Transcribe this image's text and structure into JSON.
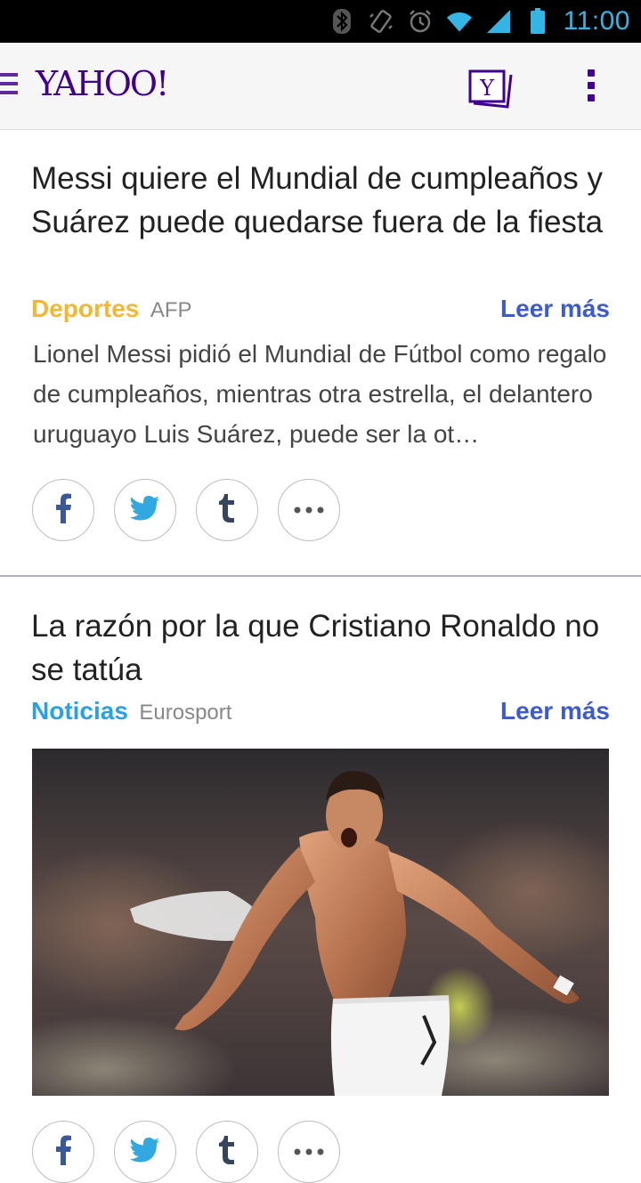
{
  "status_bar": {
    "time": "11:00",
    "icons": [
      "bluetooth-icon",
      "vibrate-icon",
      "alarm-icon",
      "wifi-icon",
      "signal-icon",
      "battery-icon"
    ]
  },
  "app_bar": {
    "logo": "YAHOO!",
    "icons": [
      "menu-icon",
      "yahoo-news-digest-icon",
      "overflow-menu-icon"
    ],
    "brand_color": "#400090"
  },
  "stories": [
    {
      "title": "Messi quiere el Mundial de cumpleaños y Suárez puede quedarse fuera de la fiesta",
      "category": "Deportes",
      "category_color": "#f5b731",
      "source": "AFP",
      "read_more": "Leer más",
      "summary": "Lionel Messi pidió el Mundial de Fútbol como regalo de cumpleaños, mientras otra estrella, el delantero uruguayo Luis Suárez, puede ser la ot…",
      "share": [
        "facebook-icon",
        "twitter-icon",
        "tumblr-icon",
        "more-icon"
      ]
    },
    {
      "title": "La razón por la que Cristiano Ronaldo no se tatúa",
      "category": "Noticias",
      "category_color": "#2aa0e8",
      "source": "Eurosport",
      "read_more": "Leer más",
      "share": [
        "facebook-icon",
        "twitter-icon",
        "tumblr-icon",
        "more-icon"
      ]
    }
  ]
}
